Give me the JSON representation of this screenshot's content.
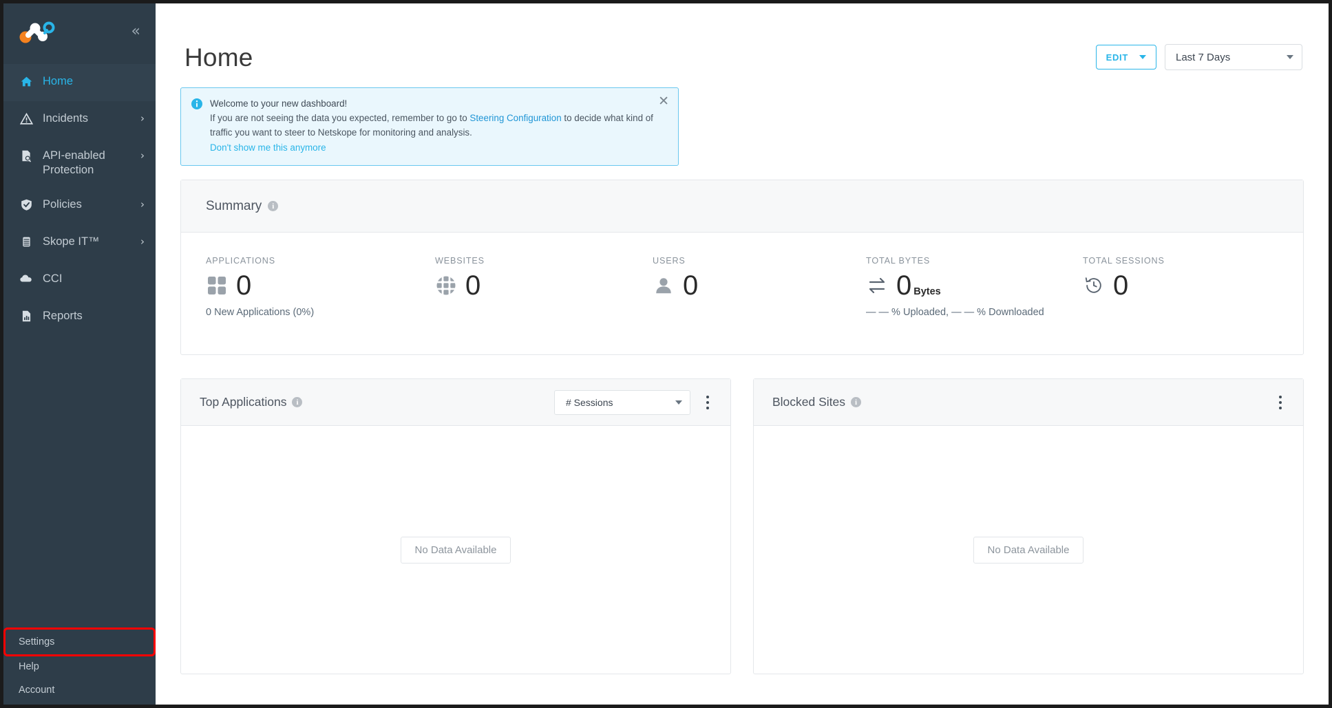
{
  "sidebar": {
    "logo_name": "netskope-logo",
    "collapse_label": "«",
    "items": [
      {
        "label": "Home",
        "icon": "home-icon",
        "active": true,
        "caret": ""
      },
      {
        "label": "Incidents",
        "icon": "warning-triangle-icon",
        "active": false,
        "caret": "›"
      },
      {
        "label": "API-enabled Protection",
        "icon": "document-search-icon",
        "active": false,
        "caret": "›"
      },
      {
        "label": "Policies",
        "icon": "shield-check-icon",
        "active": false,
        "caret": "›"
      },
      {
        "label": "Skope IT™",
        "icon": "database-icon",
        "active": false,
        "caret": "›"
      },
      {
        "label": "CCI",
        "icon": "cloud-icon",
        "active": false,
        "caret": ""
      },
      {
        "label": "Reports",
        "icon": "report-icon",
        "active": false,
        "caret": ""
      }
    ],
    "bottom_items": [
      {
        "label": "Settings",
        "highlighted": true
      },
      {
        "label": "Help",
        "highlighted": false
      },
      {
        "label": "Account",
        "highlighted": false
      }
    ]
  },
  "header": {
    "title": "Home",
    "edit_label": "EDIT",
    "date_range": "Last 7 Days"
  },
  "banner": {
    "title": "Welcome to your new dashboard!",
    "body_part1": "If you are not seeing the data you expected, remember to go to ",
    "link_text": "Steering Configuration",
    "body_part2": " to decide what kind of traffic you want to steer to Netskope for monitoring and analysis.",
    "dismiss_text": "Don't show me this anymore",
    "close_label": "✕"
  },
  "summary": {
    "title": "Summary",
    "metrics": [
      {
        "label": "APPLICATIONS",
        "value": "0",
        "unit": "",
        "sub": "0 New Applications (0%)",
        "icon": "grid-squares-icon"
      },
      {
        "label": "WEBSITES",
        "value": "0",
        "unit": "",
        "sub": "",
        "icon": "globe-grid-icon"
      },
      {
        "label": "USERS",
        "value": "0",
        "unit": "",
        "sub": "",
        "icon": "person-icon"
      },
      {
        "label": "TOTAL BYTES",
        "value": "0",
        "unit": "Bytes",
        "sub": "— — % Uploaded, — — % Downloaded",
        "icon": "transfer-arrows-icon"
      },
      {
        "label": "TOTAL SESSIONS",
        "value": "0",
        "unit": "",
        "sub": "",
        "icon": "clock-history-icon"
      }
    ]
  },
  "widgets": [
    {
      "title": "Top Applications",
      "metric_select": "# Sessions",
      "has_select": true,
      "empty_text": "No Data Available"
    },
    {
      "title": "Blocked Sites",
      "metric_select": "",
      "has_select": false,
      "empty_text": "No Data Available"
    }
  ],
  "colors": {
    "sidebar_bg": "#2e3d49",
    "accent": "#29b5e8",
    "highlight_box": "#ff0000",
    "logo_orange": "#f5821f",
    "banner_bg": "#eaf7fd"
  }
}
